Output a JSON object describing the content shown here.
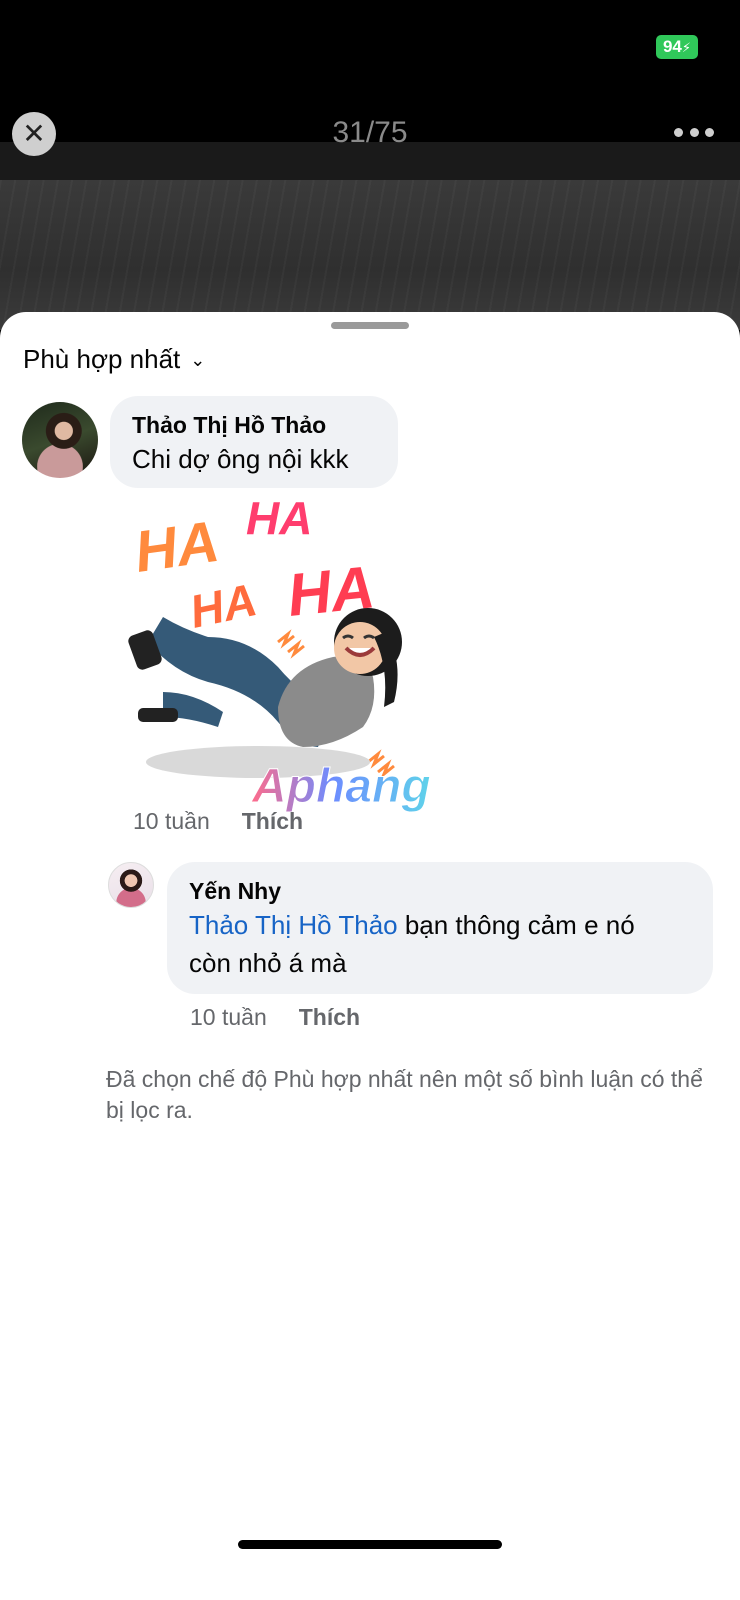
{
  "status_bar": {
    "battery": "94"
  },
  "viewer": {
    "counter": "31/75",
    "close_icon": "close-icon",
    "more_icon": "more-icon"
  },
  "sheet": {
    "sort_label": "Phù hợp nhất",
    "comments": [
      {
        "author": "Thảo Thị Hồ Thảo",
        "text": "Chi dợ ông nội kkk",
        "sticker": {
          "words": [
            "HA",
            "HA",
            "HA",
            "HA"
          ],
          "watermark": "Aphang"
        },
        "time": "10 tuần",
        "like_label": "Thích"
      },
      {
        "author": "Yến Nhy",
        "mention": "Thảo Thị Hồ Thảo",
        "text_line1": " bạn thông cảm e nó",
        "text_line2": "còn nhỏ á mà",
        "time": "10 tuần",
        "like_label": "Thích"
      }
    ],
    "filter_note": "Đã chọn chế độ Phù hợp nhất nên một số bình luận có thể bị lọc ra."
  },
  "colors": {
    "accent": "#1764c6",
    "battery": "#30c85a",
    "bubble": "#f0f2f5"
  }
}
